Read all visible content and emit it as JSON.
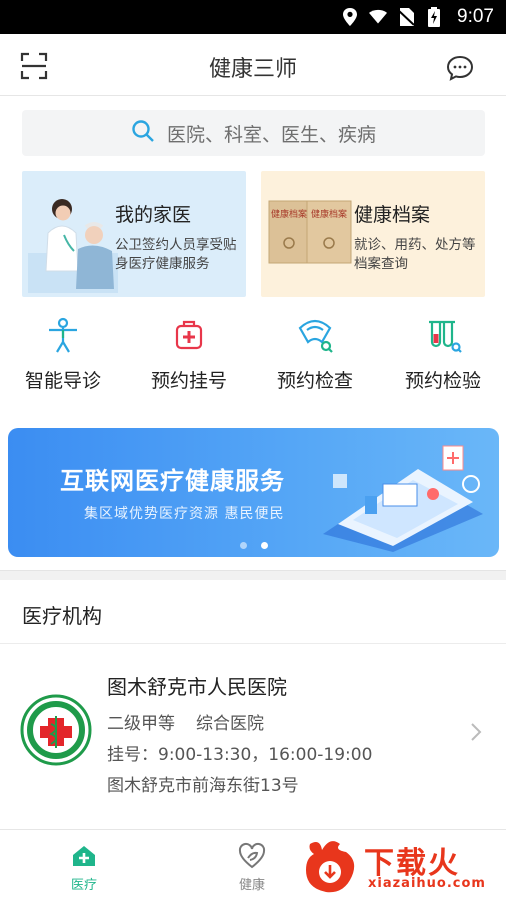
{
  "status_bar": {
    "time": "9:07",
    "icons": [
      "location-icon",
      "wifi-icon",
      "no-sim-icon",
      "battery-charging-icon"
    ]
  },
  "header": {
    "title": "健康三师",
    "left_icon": "scan-icon",
    "right_icon": "message-icon"
  },
  "search": {
    "placeholder": "医院、科室、医生、疾病"
  },
  "cards": {
    "family": {
      "title": "我的家医",
      "desc": "公卫签约人员享受贴身医疗健康服务"
    },
    "record": {
      "title": "健康档案",
      "desc": "就诊、用药、处方等档案查询",
      "folder_label": "健康档案"
    }
  },
  "quick_nav": [
    {
      "label": "智能导诊",
      "icon": "body-guide-icon"
    },
    {
      "label": "预约挂号",
      "icon": "medical-kit-icon"
    },
    {
      "label": "预约检查",
      "icon": "ultrasound-search-icon"
    },
    {
      "label": "预约检验",
      "icon": "test-tube-search-icon"
    }
  ],
  "banner": {
    "title": "互联网医疗健康服务",
    "subtitle": "集区域优势医疗资源 惠民便民",
    "slide_count": 2,
    "active_slide": 2
  },
  "section": {
    "title": "医疗机构"
  },
  "hospital": {
    "name": "图木舒克市人民医院",
    "level": "二级甲等",
    "type": "综合医院",
    "hours": "挂号：9:00-13:30，16:00-19:00",
    "address": "图木舒克市前海东街13号"
  },
  "tabs": [
    {
      "label": "医疗",
      "icon": "hospital-home-icon",
      "active": true
    },
    {
      "label": "健康",
      "icon": "heart-leaf-icon",
      "active": false
    }
  ],
  "watermark": {
    "text": "下载火",
    "url": "xiazaihuo.com"
  },
  "colors": {
    "accent": "#1fb58b",
    "search_icon": "#2aa5e0",
    "banner_blue": "#3b8df2",
    "family_card": "#dbedfa",
    "record_card": "#fdf1dc",
    "watermark": "#e8361c"
  }
}
